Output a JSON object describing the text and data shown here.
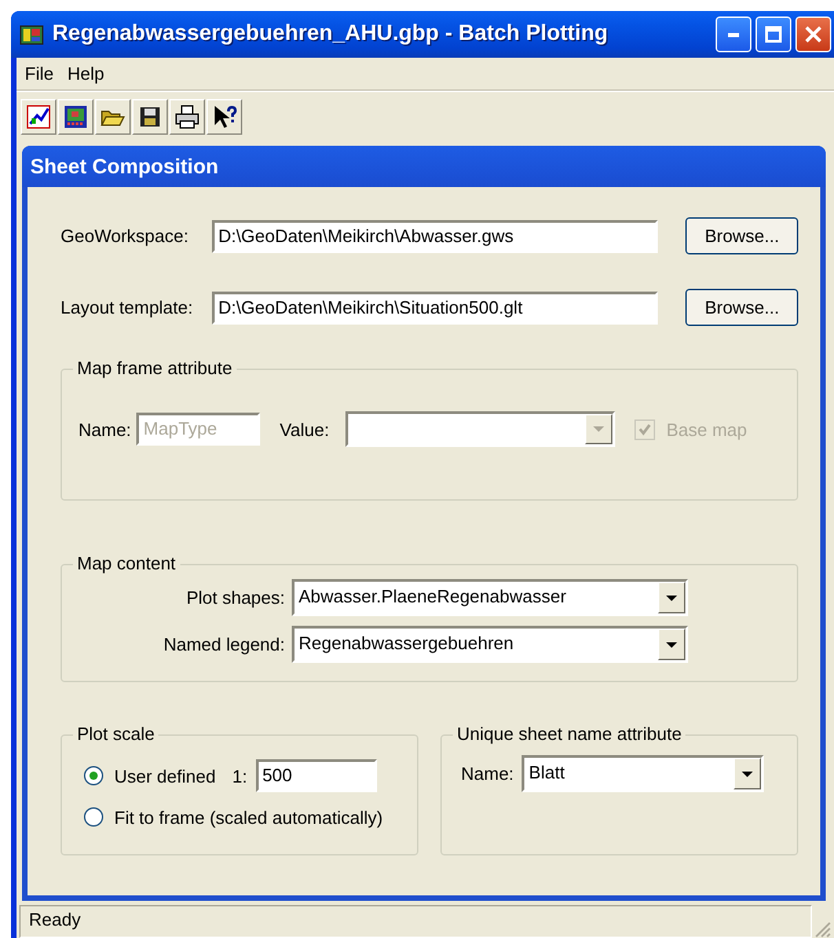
{
  "window": {
    "title": "Regenabwassergebuehren_AHU.gbp - Batch Plotting"
  },
  "menu": [
    {
      "label": "File"
    },
    {
      "label": "Help"
    }
  ],
  "panel": {
    "title": "Sheet Composition"
  },
  "paths": [
    {
      "label": "GeoWorkspace:",
      "value": "D:\\GeoDaten\\Meikirch\\Abwasser.gws",
      "button": "Browse..."
    },
    {
      "label": "Layout template:",
      "value": "D:\\GeoDaten\\Meikirch\\Situation500.glt",
      "button": "Browse..."
    }
  ],
  "map_frame": {
    "title": "Map frame attribute",
    "disabled": true,
    "name_label": "Name:",
    "name_value": "MapType",
    "value_label": "Value:",
    "basemap_label": "Base map",
    "basemap_checked": true
  },
  "map_content": {
    "title": "Map content",
    "fields": [
      {
        "label": "Plot shapes:",
        "value": "Abwasser.PlaeneRegenabwasser"
      },
      {
        "label": "Named legend:",
        "value": "Regenabwassergebuehren"
      }
    ]
  },
  "plot_scale": {
    "title": "Plot scale",
    "options": [
      {
        "kind": "user",
        "label": "User defined",
        "prefix": "1:",
        "value": "500",
        "selected": true
      },
      {
        "kind": "fit",
        "label": "Fit to frame (scaled automatically)",
        "selected": false
      }
    ]
  },
  "sheet_name": {
    "title": "Unique sheet name attribute",
    "label": "Name:",
    "value": "Blatt"
  },
  "status_bar": "Ready"
}
